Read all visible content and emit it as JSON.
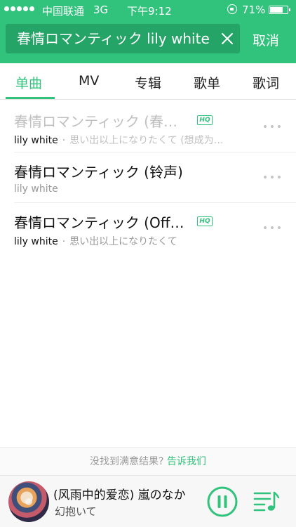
{
  "status_bar": {
    "carrier": "中国联通",
    "network": "3G",
    "time": "下午9:12",
    "battery_percent": "71%",
    "battery_level": 0.71
  },
  "search": {
    "query": "春情ロマンティック lily white",
    "cancel_label": "取消"
  },
  "tabs": [
    {
      "label": "单曲",
      "active": true
    },
    {
      "label": "MV",
      "active": false
    },
    {
      "label": "专辑",
      "active": false
    },
    {
      "label": "歌单",
      "active": false
    },
    {
      "label": "歌词",
      "active": false
    }
  ],
  "results": [
    {
      "title": "春情ロマンティック (春…",
      "hq": "HQ",
      "artist": "lily white",
      "separator": "·",
      "album": "思い出以上になりたくて (想成为…"
    },
    {
      "title": "春情ロマンティック (铃声)",
      "artist": "lily white"
    },
    {
      "title": "春情ロマンティック (Off…",
      "hq": "HQ",
      "artist": "lily white",
      "separator": "·",
      "album": "思い出以上になりたくて"
    }
  ],
  "feedback": {
    "prompt": "没找到满意结果?",
    "link": "告诉我们"
  },
  "now_playing": {
    "title": "(风雨中的爱恋) 嵐のなか",
    "subtitle": "幻抱いて"
  },
  "colors": {
    "accent": "#31c27c",
    "search_bg": "#24a466"
  }
}
